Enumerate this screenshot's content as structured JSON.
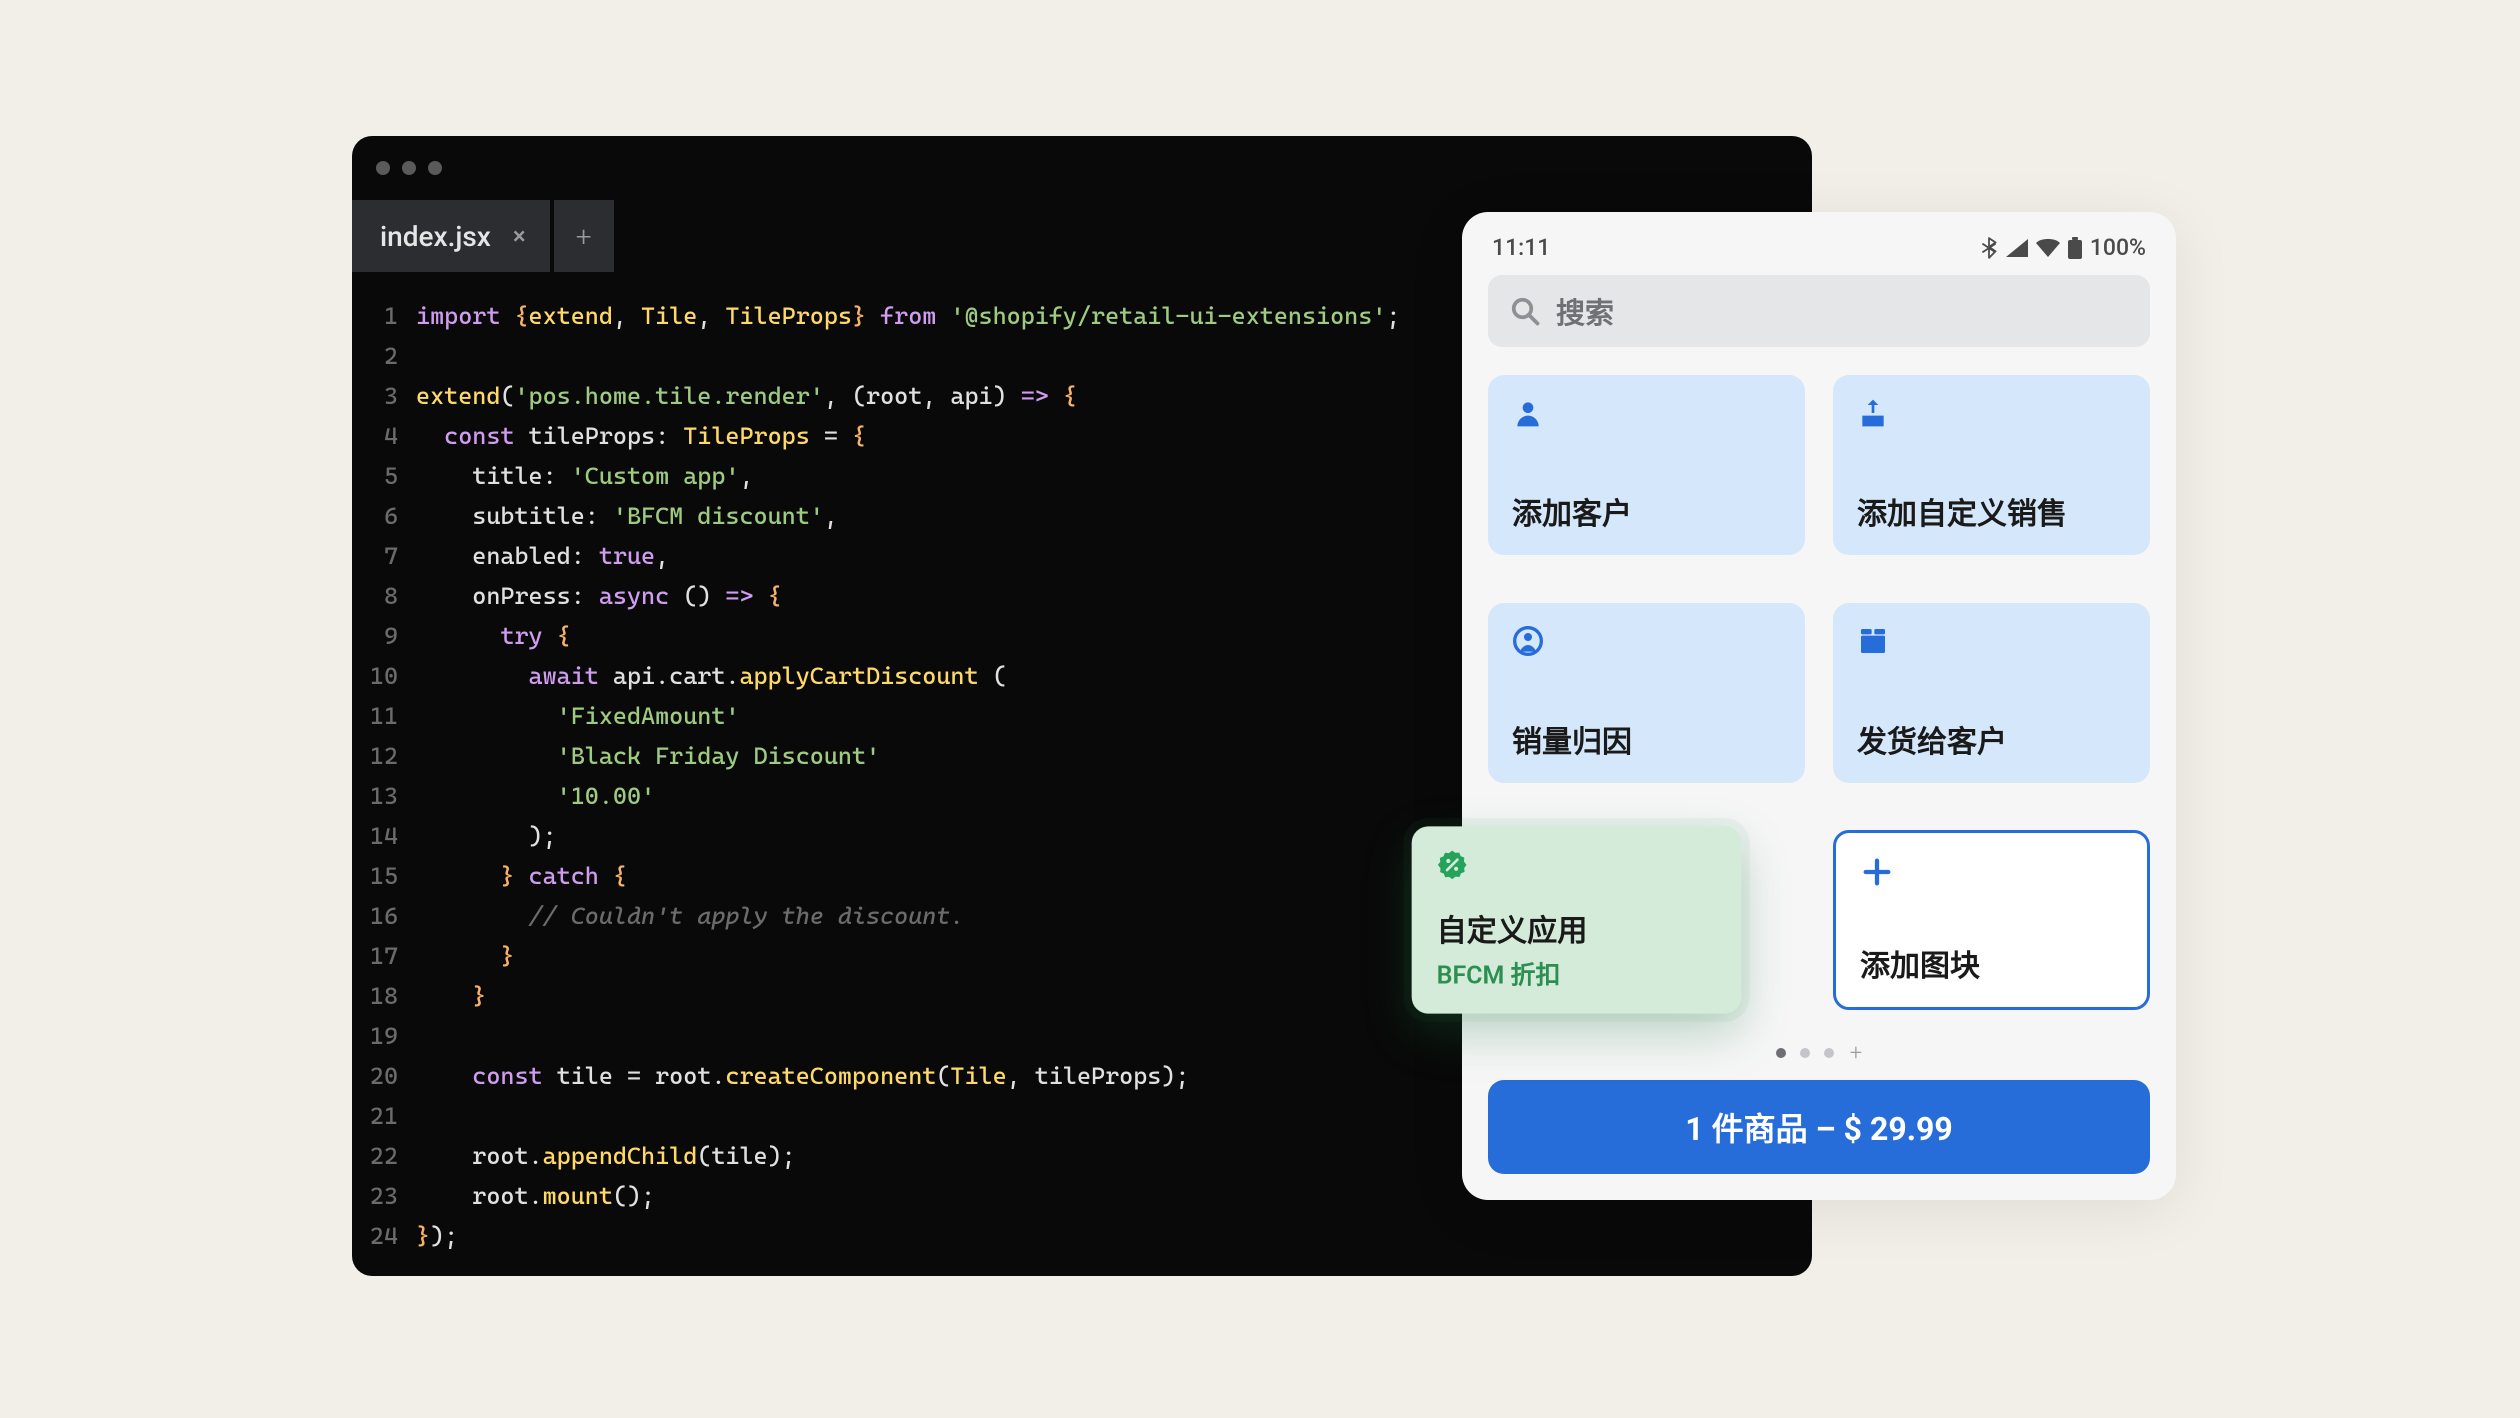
{
  "editor": {
    "tab_name": "index.jsx",
    "line_count": 24,
    "code_lines": [
      [
        [
          "kw",
          "import"
        ],
        [
          "id",
          " "
        ],
        [
          "punc",
          "{"
        ],
        [
          "method",
          "extend"
        ],
        [
          "id",
          ", "
        ],
        [
          "type",
          "Tile"
        ],
        [
          "id",
          ", "
        ],
        [
          "type",
          "TileProps"
        ],
        [
          "punc",
          "}"
        ],
        [
          "id",
          " "
        ],
        [
          "kw",
          "from"
        ],
        [
          "id",
          " "
        ],
        [
          "str",
          "'@shopify/retail-ui-extensions'"
        ],
        [
          "id",
          ";"
        ]
      ],
      [],
      [
        [
          "method",
          "extend"
        ],
        [
          "id",
          "("
        ],
        [
          "str",
          "'pos.home.tile.render'"
        ],
        [
          "id",
          ", (root, api) "
        ],
        [
          "kw",
          "=>"
        ],
        [
          "id",
          " "
        ],
        [
          "punc",
          "{"
        ]
      ],
      [
        [
          "id",
          "  "
        ],
        [
          "kw",
          "const"
        ],
        [
          "id",
          " "
        ],
        [
          "id",
          "tileProps"
        ],
        [
          "id",
          ": "
        ],
        [
          "type",
          "TileProps"
        ],
        [
          "id",
          " = "
        ],
        [
          "punc",
          "{"
        ]
      ],
      [
        [
          "id",
          "    title: "
        ],
        [
          "str",
          "'Custom app'"
        ],
        [
          "id",
          ","
        ]
      ],
      [
        [
          "id",
          "    subtitle: "
        ],
        [
          "str",
          "'BFCM discount'"
        ],
        [
          "id",
          ","
        ]
      ],
      [
        [
          "id",
          "    enabled: "
        ],
        [
          "bool",
          "true"
        ],
        [
          "id",
          ","
        ]
      ],
      [
        [
          "id",
          "    onPress: "
        ],
        [
          "kw",
          "async"
        ],
        [
          "id",
          " () "
        ],
        [
          "kw",
          "=>"
        ],
        [
          "id",
          " "
        ],
        [
          "punc",
          "{"
        ]
      ],
      [
        [
          "id",
          "      "
        ],
        [
          "kw",
          "try"
        ],
        [
          "id",
          " "
        ],
        [
          "punc",
          "{"
        ]
      ],
      [
        [
          "id",
          "        "
        ],
        [
          "kw",
          "await"
        ],
        [
          "id",
          " api.cart."
        ],
        [
          "method",
          "applyCartDiscount"
        ],
        [
          "id",
          " ("
        ]
      ],
      [
        [
          "id",
          "          "
        ],
        [
          "str",
          "'FixedAmount'"
        ]
      ],
      [
        [
          "id",
          "          "
        ],
        [
          "str",
          "'Black Friday Discount'"
        ]
      ],
      [
        [
          "id",
          "          "
        ],
        [
          "str",
          "'10.00'"
        ]
      ],
      [
        [
          "id",
          "        );"
        ]
      ],
      [
        [
          "id",
          "      "
        ],
        [
          "punc",
          "}"
        ],
        [
          "id",
          " "
        ],
        [
          "kw",
          "catch"
        ],
        [
          "id",
          " "
        ],
        [
          "punc",
          "{"
        ]
      ],
      [
        [
          "id",
          "        "
        ],
        [
          "comment",
          "// Couldn't apply the discount."
        ]
      ],
      [
        [
          "id",
          "      "
        ],
        [
          "punc",
          "}"
        ]
      ],
      [
        [
          "id",
          "    "
        ],
        [
          "punc",
          "}"
        ]
      ],
      [],
      [
        [
          "id",
          "    "
        ],
        [
          "kw",
          "const"
        ],
        [
          "id",
          " tile = root."
        ],
        [
          "method",
          "createComponent"
        ],
        [
          "id",
          "("
        ],
        [
          "type",
          "Tile"
        ],
        [
          "id",
          ", tileProps);"
        ]
      ],
      [],
      [
        [
          "id",
          "    root."
        ],
        [
          "method",
          "appendChild"
        ],
        [
          "id",
          "(tile);"
        ]
      ],
      [
        [
          "id",
          "    root."
        ],
        [
          "method",
          "mount"
        ],
        [
          "id",
          "();"
        ]
      ],
      [
        [
          "punc",
          "}"
        ],
        [
          "id",
          ");"
        ]
      ]
    ]
  },
  "pos": {
    "time": "11:11",
    "battery": "100%",
    "search_placeholder": "搜索",
    "tiles": {
      "add_customer": "添加客户",
      "add_custom_sale": "添加自定义销售",
      "sales_attribution": "销量归因",
      "ship_to_customer": "发货给客户",
      "custom_app_title": "自定义应用",
      "custom_app_subtitle": "BFCM 折扣",
      "add_tile": "添加图块"
    },
    "cart_button": "1 件商品 – $ 29.99"
  }
}
